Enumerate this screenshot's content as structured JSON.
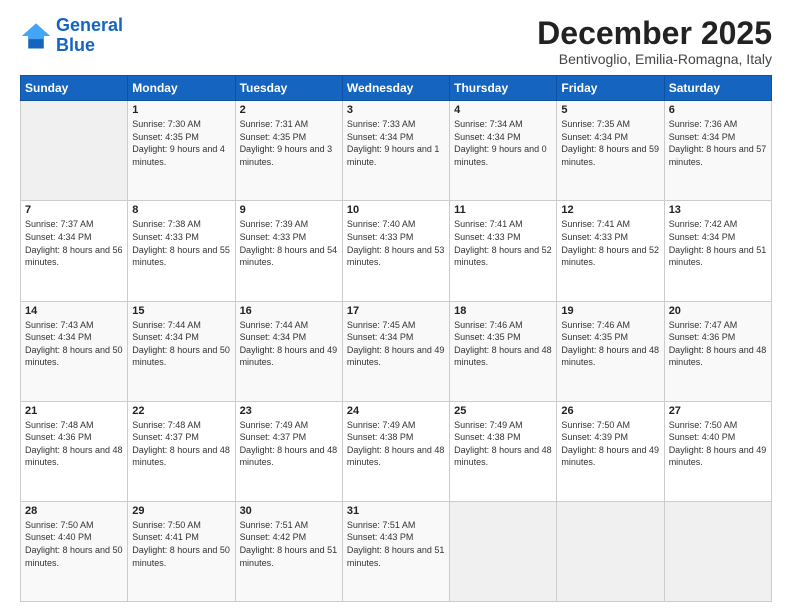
{
  "logo": {
    "line1": "General",
    "line2": "Blue"
  },
  "title": "December 2025",
  "location": "Bentivoglio, Emilia-Romagna, Italy",
  "days_header": [
    "Sunday",
    "Monday",
    "Tuesday",
    "Wednesday",
    "Thursday",
    "Friday",
    "Saturday"
  ],
  "weeks": [
    [
      {
        "day": "",
        "sunrise": "",
        "sunset": "",
        "daylight": ""
      },
      {
        "day": "1",
        "sunrise": "Sunrise: 7:30 AM",
        "sunset": "Sunset: 4:35 PM",
        "daylight": "Daylight: 9 hours and 4 minutes."
      },
      {
        "day": "2",
        "sunrise": "Sunrise: 7:31 AM",
        "sunset": "Sunset: 4:35 PM",
        "daylight": "Daylight: 9 hours and 3 minutes."
      },
      {
        "day": "3",
        "sunrise": "Sunrise: 7:33 AM",
        "sunset": "Sunset: 4:34 PM",
        "daylight": "Daylight: 9 hours and 1 minute."
      },
      {
        "day": "4",
        "sunrise": "Sunrise: 7:34 AM",
        "sunset": "Sunset: 4:34 PM",
        "daylight": "Daylight: 9 hours and 0 minutes."
      },
      {
        "day": "5",
        "sunrise": "Sunrise: 7:35 AM",
        "sunset": "Sunset: 4:34 PM",
        "daylight": "Daylight: 8 hours and 59 minutes."
      },
      {
        "day": "6",
        "sunrise": "Sunrise: 7:36 AM",
        "sunset": "Sunset: 4:34 PM",
        "daylight": "Daylight: 8 hours and 57 minutes."
      }
    ],
    [
      {
        "day": "7",
        "sunrise": "Sunrise: 7:37 AM",
        "sunset": "Sunset: 4:34 PM",
        "daylight": "Daylight: 8 hours and 56 minutes."
      },
      {
        "day": "8",
        "sunrise": "Sunrise: 7:38 AM",
        "sunset": "Sunset: 4:33 PM",
        "daylight": "Daylight: 8 hours and 55 minutes."
      },
      {
        "day": "9",
        "sunrise": "Sunrise: 7:39 AM",
        "sunset": "Sunset: 4:33 PM",
        "daylight": "Daylight: 8 hours and 54 minutes."
      },
      {
        "day": "10",
        "sunrise": "Sunrise: 7:40 AM",
        "sunset": "Sunset: 4:33 PM",
        "daylight": "Daylight: 8 hours and 53 minutes."
      },
      {
        "day": "11",
        "sunrise": "Sunrise: 7:41 AM",
        "sunset": "Sunset: 4:33 PM",
        "daylight": "Daylight: 8 hours and 52 minutes."
      },
      {
        "day": "12",
        "sunrise": "Sunrise: 7:41 AM",
        "sunset": "Sunset: 4:33 PM",
        "daylight": "Daylight: 8 hours and 52 minutes."
      },
      {
        "day": "13",
        "sunrise": "Sunrise: 7:42 AM",
        "sunset": "Sunset: 4:34 PM",
        "daylight": "Daylight: 8 hours and 51 minutes."
      }
    ],
    [
      {
        "day": "14",
        "sunrise": "Sunrise: 7:43 AM",
        "sunset": "Sunset: 4:34 PM",
        "daylight": "Daylight: 8 hours and 50 minutes."
      },
      {
        "day": "15",
        "sunrise": "Sunrise: 7:44 AM",
        "sunset": "Sunset: 4:34 PM",
        "daylight": "Daylight: 8 hours and 50 minutes."
      },
      {
        "day": "16",
        "sunrise": "Sunrise: 7:44 AM",
        "sunset": "Sunset: 4:34 PM",
        "daylight": "Daylight: 8 hours and 49 minutes."
      },
      {
        "day": "17",
        "sunrise": "Sunrise: 7:45 AM",
        "sunset": "Sunset: 4:34 PM",
        "daylight": "Daylight: 8 hours and 49 minutes."
      },
      {
        "day": "18",
        "sunrise": "Sunrise: 7:46 AM",
        "sunset": "Sunset: 4:35 PM",
        "daylight": "Daylight: 8 hours and 48 minutes."
      },
      {
        "day": "19",
        "sunrise": "Sunrise: 7:46 AM",
        "sunset": "Sunset: 4:35 PM",
        "daylight": "Daylight: 8 hours and 48 minutes."
      },
      {
        "day": "20",
        "sunrise": "Sunrise: 7:47 AM",
        "sunset": "Sunset: 4:36 PM",
        "daylight": "Daylight: 8 hours and 48 minutes."
      }
    ],
    [
      {
        "day": "21",
        "sunrise": "Sunrise: 7:48 AM",
        "sunset": "Sunset: 4:36 PM",
        "daylight": "Daylight: 8 hours and 48 minutes."
      },
      {
        "day": "22",
        "sunrise": "Sunrise: 7:48 AM",
        "sunset": "Sunset: 4:37 PM",
        "daylight": "Daylight: 8 hours and 48 minutes."
      },
      {
        "day": "23",
        "sunrise": "Sunrise: 7:49 AM",
        "sunset": "Sunset: 4:37 PM",
        "daylight": "Daylight: 8 hours and 48 minutes."
      },
      {
        "day": "24",
        "sunrise": "Sunrise: 7:49 AM",
        "sunset": "Sunset: 4:38 PM",
        "daylight": "Daylight: 8 hours and 48 minutes."
      },
      {
        "day": "25",
        "sunrise": "Sunrise: 7:49 AM",
        "sunset": "Sunset: 4:38 PM",
        "daylight": "Daylight: 8 hours and 48 minutes."
      },
      {
        "day": "26",
        "sunrise": "Sunrise: 7:50 AM",
        "sunset": "Sunset: 4:39 PM",
        "daylight": "Daylight: 8 hours and 49 minutes."
      },
      {
        "day": "27",
        "sunrise": "Sunrise: 7:50 AM",
        "sunset": "Sunset: 4:40 PM",
        "daylight": "Daylight: 8 hours and 49 minutes."
      }
    ],
    [
      {
        "day": "28",
        "sunrise": "Sunrise: 7:50 AM",
        "sunset": "Sunset: 4:40 PM",
        "daylight": "Daylight: 8 hours and 50 minutes."
      },
      {
        "day": "29",
        "sunrise": "Sunrise: 7:50 AM",
        "sunset": "Sunset: 4:41 PM",
        "daylight": "Daylight: 8 hours and 50 minutes."
      },
      {
        "day": "30",
        "sunrise": "Sunrise: 7:51 AM",
        "sunset": "Sunset: 4:42 PM",
        "daylight": "Daylight: 8 hours and 51 minutes."
      },
      {
        "day": "31",
        "sunrise": "Sunrise: 7:51 AM",
        "sunset": "Sunset: 4:43 PM",
        "daylight": "Daylight: 8 hours and 51 minutes."
      },
      {
        "day": "",
        "sunrise": "",
        "sunset": "",
        "daylight": ""
      },
      {
        "day": "",
        "sunrise": "",
        "sunset": "",
        "daylight": ""
      },
      {
        "day": "",
        "sunrise": "",
        "sunset": "",
        "daylight": ""
      }
    ]
  ]
}
